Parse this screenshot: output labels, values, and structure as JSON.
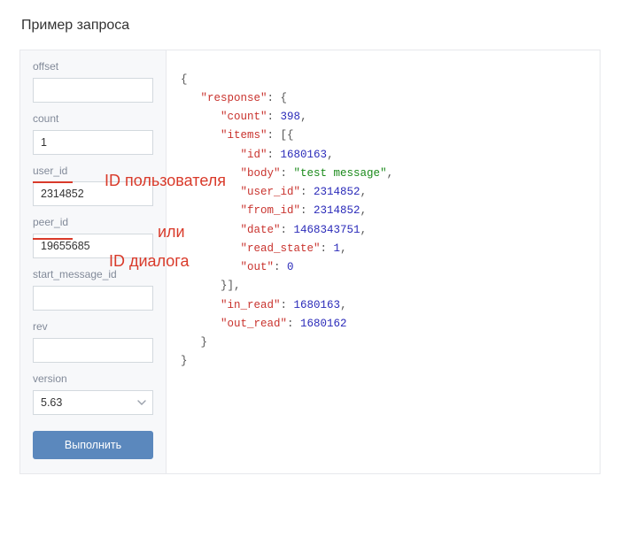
{
  "title": "Пример запроса",
  "sidebar": {
    "fields": {
      "offset": {
        "label": "offset",
        "value": ""
      },
      "count": {
        "label": "count",
        "value": "1"
      },
      "user_id": {
        "label": "user_id",
        "value": "2314852"
      },
      "peer_id": {
        "label": "peer_id",
        "value": "19655685"
      },
      "start_id": {
        "label": "start_message_id",
        "value": ""
      },
      "rev": {
        "label": "rev",
        "value": ""
      },
      "version": {
        "label": "version",
        "value": "5.63"
      }
    },
    "execute_label": "Выполнить"
  },
  "response": {
    "count": 398,
    "items": [
      {
        "id": 1680163,
        "body": "test message",
        "user_id": 2314852,
        "from_id": 2314852,
        "date": 1468343751,
        "read_state": 1,
        "out": 0
      }
    ],
    "in_read": 1680163,
    "out_read": 1680162
  },
  "annotations": {
    "user_id_note": "ID пользователя",
    "middle_note": "или",
    "peer_id_note": "ID диалога"
  }
}
